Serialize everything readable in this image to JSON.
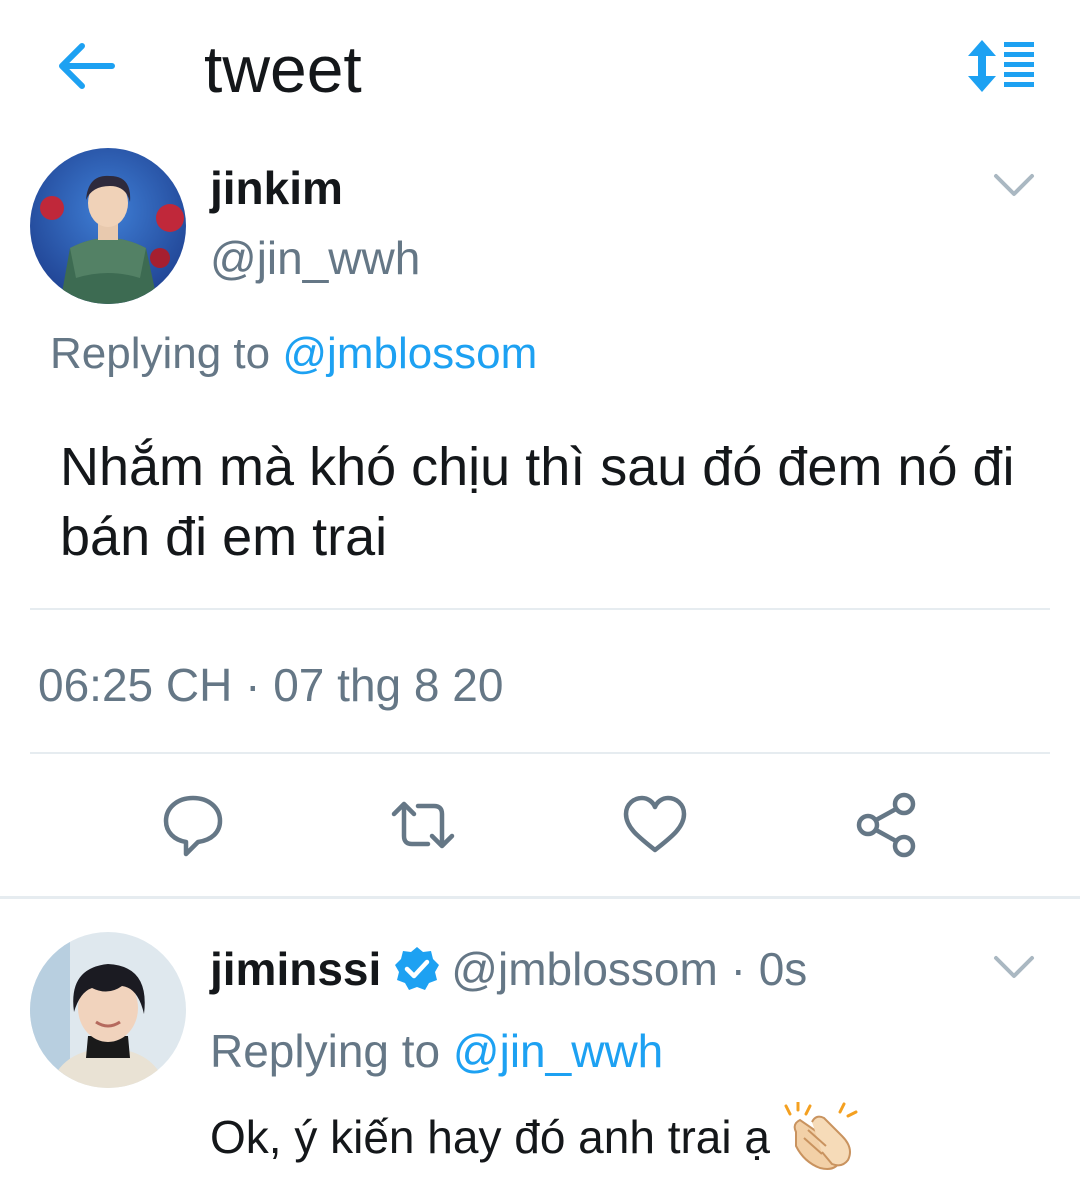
{
  "header": {
    "title": "tweet",
    "back_icon": "arrow-left-icon",
    "sort_icon": "sort-list-icon",
    "accent": "#1da1f2"
  },
  "main_tweet": {
    "display_name": "jinkim",
    "handle": "@jin_wwh",
    "replying_prefix": "Replying to",
    "replying_to": "@jmblossom",
    "text": "Nhắm mà khó chịu thì sau đó đem nó đi bán đi em trai",
    "timestamp": "06:25 CH · 07 thg 8 20",
    "actions": [
      "reply-icon",
      "retweet-icon",
      "like-icon",
      "share-icon"
    ]
  },
  "reply_tweet": {
    "display_name": "jiminssi",
    "verified": true,
    "handle_time": "@jmblossom · 0s",
    "replying_prefix": "Replying to",
    "replying_to": "@jin_wwh",
    "text": "Ok, ý kiến hay đó anh trai ạ",
    "emoji": "clapping-hands-icon"
  },
  "colors": {
    "text": "#14171a",
    "secondary": "#657786",
    "link": "#1da1f2",
    "divider": "#e6ecf0"
  }
}
